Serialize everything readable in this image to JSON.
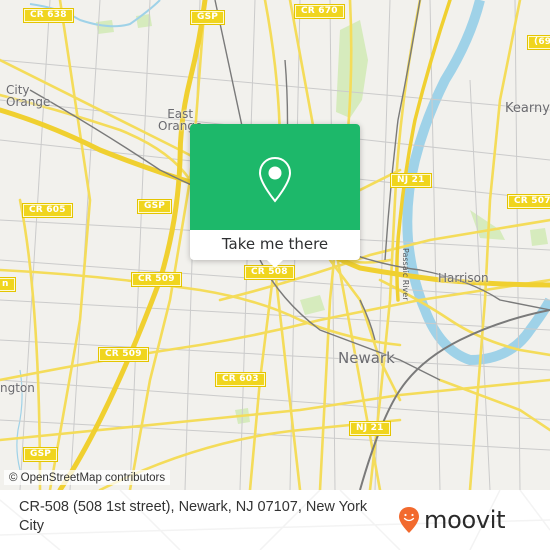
{
  "map": {
    "colors": {
      "background": "#f2f1ed",
      "road_major": "#f4dc5a",
      "road_minor": "#c9c9c9",
      "water": "#9fd2e8",
      "park": "#d6ebbd",
      "rail": "#808080"
    },
    "places": [
      {
        "name": "city-label-city-orange",
        "text": "City\nOrange"
      },
      {
        "name": "city-label-east-orange",
        "text": "East\nOrange"
      },
      {
        "name": "city-label-kearny",
        "text": "Kearny"
      },
      {
        "name": "city-label-harrison",
        "text": "Harrison"
      },
      {
        "name": "city-label-newark",
        "text": "Newark"
      },
      {
        "name": "city-label-irvington",
        "text": "ngton"
      }
    ],
    "river_label": "Passaic River",
    "shields": [
      {
        "name": "shield-cr-638",
        "text": "CR 638"
      },
      {
        "name": "shield-gsp-north",
        "text": "GSP"
      },
      {
        "name": "shield-cr-670",
        "text": "CR 670"
      },
      {
        "name": "shield-69x",
        "text": "(69"
      },
      {
        "name": "shield-cr-605",
        "text": "CR 605"
      },
      {
        "name": "shield-gsp-mid",
        "text": "GSP"
      },
      {
        "name": "shield-nj-21-north",
        "text": "NJ 21"
      },
      {
        "name": "shield-cr-507",
        "text": "CR 507"
      },
      {
        "name": "shield-cr-509-a",
        "text": "CR 509"
      },
      {
        "name": "shield-cr-508",
        "text": "CR 508"
      },
      {
        "name": "shield-cr-509-b",
        "text": "CR 509"
      },
      {
        "name": "shield-cr-603",
        "text": "CR 603"
      },
      {
        "name": "shield-nj-21-south",
        "text": "NJ 21"
      },
      {
        "name": "shield-gsp-south",
        "text": "GSP"
      },
      {
        "name": "shield-partial-left",
        "text": "n"
      }
    ],
    "attribution": "© OpenStreetMap contributors"
  },
  "popup": {
    "icon": "map-pin-icon",
    "button_label": "Take me there",
    "color": "#1db86a"
  },
  "footer": {
    "address": "CR-508 (508 1st street), Newark, NJ 07107, New York City",
    "brand": "moovit",
    "brand_icon": "moovit-smiley-pin-icon",
    "brand_color": "#f26a2e"
  }
}
